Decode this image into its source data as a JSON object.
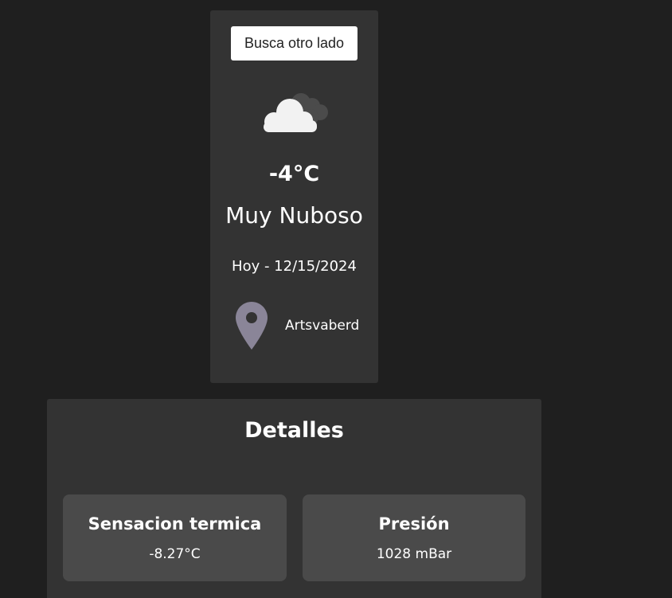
{
  "search": {
    "button_label": "Busca otro lado"
  },
  "current": {
    "icon": "cloud-icon",
    "temperature": "-4°C",
    "condition": "Muy Nuboso",
    "date": "Hoy - 12/15/2024",
    "location_icon": "location-pin-icon",
    "location": "Artsvaberd"
  },
  "details": {
    "title": "Detalles",
    "items": [
      {
        "label": "Sensacion termica",
        "value": "-8.27°C"
      },
      {
        "label": "Presión",
        "value": "1028 mBar"
      }
    ]
  },
  "colors": {
    "background": "#1f1f1f",
    "card": "#333333",
    "tile": "#4a4a4a",
    "pin": "#8a8598",
    "cloud_front": "#f2f2f2",
    "cloud_back": "#4b4b4b"
  }
}
